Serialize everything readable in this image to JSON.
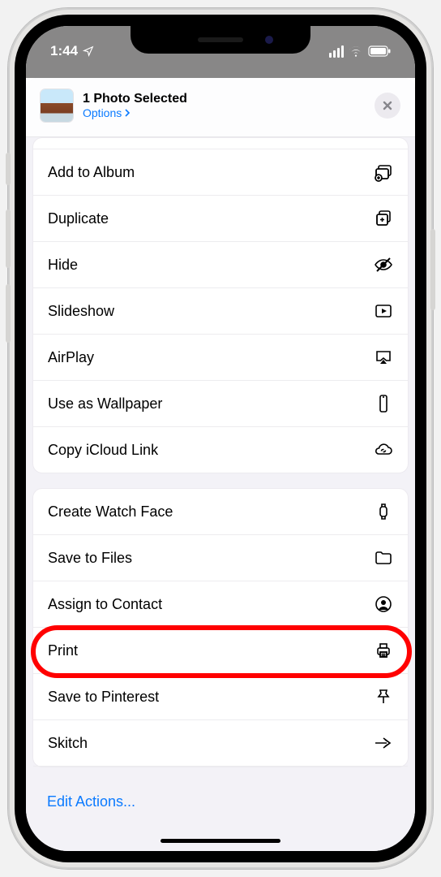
{
  "status": {
    "time": "1:44"
  },
  "header": {
    "title": "1 Photo Selected",
    "options": "Options"
  },
  "group1": {
    "addToAlbum": "Add to Album",
    "duplicate": "Duplicate",
    "hide": "Hide",
    "slideshow": "Slideshow",
    "airplay": "AirPlay",
    "wallpaper": "Use as Wallpaper",
    "icloud": "Copy iCloud Link"
  },
  "group2": {
    "watchface": "Create Watch Face",
    "savefiles": "Save to Files",
    "assign": "Assign to Contact",
    "print": "Print",
    "pinterest": "Save to Pinterest",
    "skitch": "Skitch"
  },
  "footer": {
    "edit": "Edit Actions..."
  },
  "highlightRow": "print"
}
